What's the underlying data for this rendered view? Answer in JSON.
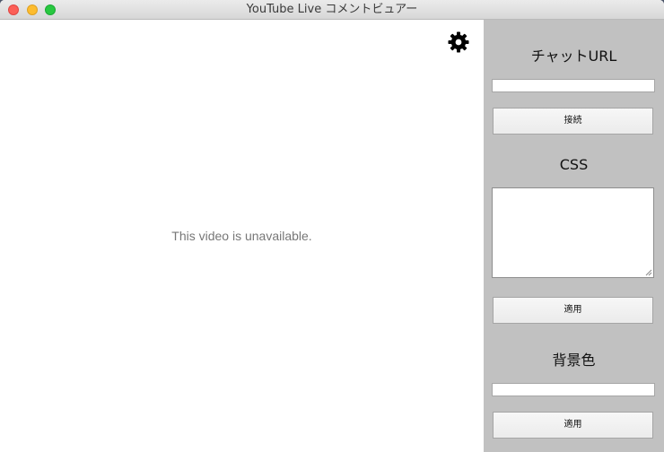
{
  "window": {
    "title": "YouTube Live コメントビュアー"
  },
  "video": {
    "message": "This video is unavailable."
  },
  "sidebar": {
    "chat_url": {
      "label": "チャットURL",
      "value": "",
      "connect_label": "接続"
    },
    "css": {
      "label": "CSS",
      "value": "",
      "apply_label": "適用"
    },
    "background_color": {
      "label": "背景色",
      "value": "",
      "apply_label": "適用"
    }
  },
  "icons": {
    "settings": "gear-icon"
  }
}
